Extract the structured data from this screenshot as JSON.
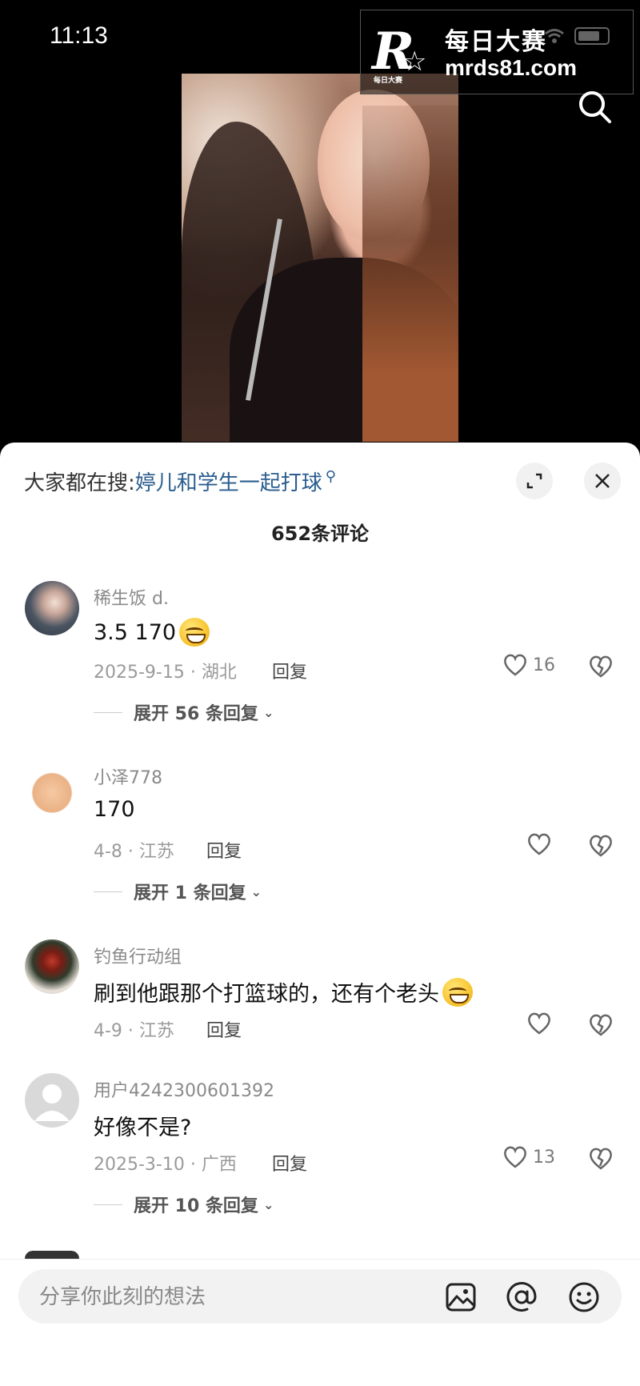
{
  "status_bar": {
    "time": "11:13"
  },
  "watermark": {
    "logo_letter": "R",
    "logo_small": "每日大赛",
    "title": "每日大赛",
    "url": "mrds81.com"
  },
  "sheet": {
    "hot_search_label": "大家都在搜:",
    "hot_search_term": "婷儿和学生一起打球",
    "comment_count": "652条评论"
  },
  "comments": [
    {
      "username": "稀生饭 d.",
      "text": "3.5 170",
      "emoji": "emoji-smirk",
      "date_location": "2025-9-15 · 湖北",
      "reply_label": "回复",
      "likes": "16",
      "expand_label": "展开 56 条回复"
    },
    {
      "username": "小泽778",
      "text": "170",
      "date_location": "4-8 · 江苏",
      "reply_label": "回复",
      "likes": "",
      "expand_label": "展开 1 条回复"
    },
    {
      "username": "钓鱼行动组",
      "text": "刷到他跟那个打篮球的，还有个老头",
      "emoji": "emoji-sweat-grin",
      "date_location": "4-9 · 江苏",
      "reply_label": "回复",
      "likes": ""
    },
    {
      "username": "用户4242300601392",
      "text": "好像不是?",
      "date_location": "2025-3-10 · 广西",
      "reply_label": "回复",
      "likes": "13",
      "expand_label": "展开 10 条回复"
    }
  ],
  "input": {
    "placeholder": "分享你此刻的想法"
  },
  "colors": {
    "link": "#2b5d8e",
    "sheet_bg": "#ffffff",
    "muted": "#8a8a8a"
  }
}
